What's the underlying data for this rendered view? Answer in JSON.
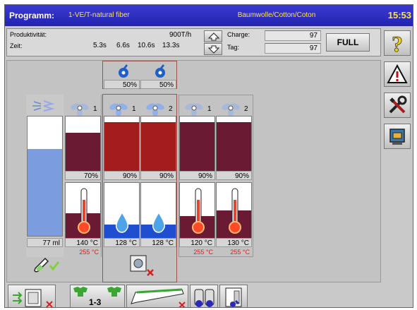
{
  "titlebar": {
    "label": "Programm:",
    "program": "1-VE/T-natural fiber",
    "material": "Baumwolle/Cotton/Coton",
    "time": "15:53"
  },
  "info": {
    "produktivitaet_label": "Produktivität:",
    "produktivitaet_value": "900T/h",
    "zeit_label": "Zeit:",
    "zeit_values": [
      "5.3s",
      "6.6s",
      "10.6s",
      "13.3s"
    ],
    "charge_label": "Charge:",
    "charge_value": "97",
    "tag_label": "Tag:",
    "tag_value": "97",
    "full_label": "FULL"
  },
  "top_fans": [
    {
      "pct": "50%"
    },
    {
      "pct": "50%"
    }
  ],
  "columns": [
    {
      "fan_num": "",
      "pct": "",
      "temp": "77 ml",
      "setpoint": ""
    },
    {
      "fan_num": "1",
      "pct": "70%",
      "fill": 0.7,
      "temp": "140 °C",
      "setpoint": "255 °C",
      "temp_level": 0.45
    },
    {
      "fan_num": "1",
      "pct": "90%",
      "fill": 0.9,
      "temp": "128 °C",
      "setpoint": "",
      "water_level": 0.25
    },
    {
      "fan_num": "2",
      "pct": "90%",
      "fill": 0.9,
      "temp": "128 °C",
      "setpoint": "",
      "water_level": 0.25
    },
    {
      "fan_num": "1",
      "pct": "90%",
      "fill": 0.9,
      "temp": "120 °C",
      "setpoint": "255 °C",
      "temp_level": 0.4
    },
    {
      "fan_num": "2",
      "pct": "90%",
      "fill": 0.9,
      "temp": "130 °C",
      "setpoint": "255 °C",
      "temp_level": 0.5
    }
  ],
  "reservoir_fill": 0.73,
  "bottom": {
    "step_label": "1-3"
  },
  "colors": {
    "titlebar": "#2a2ab8",
    "title_text": "#ffe34a",
    "maroon": "#6a1a32",
    "red": "#a41c1c",
    "blue_fill": "#7b9de0",
    "setpoint": "#d32020"
  },
  "icons": [
    "help-icon",
    "warning-icon",
    "tools-icon",
    "screen-icon",
    "fan-icon",
    "thermometer-icon",
    "drop-icon"
  ]
}
